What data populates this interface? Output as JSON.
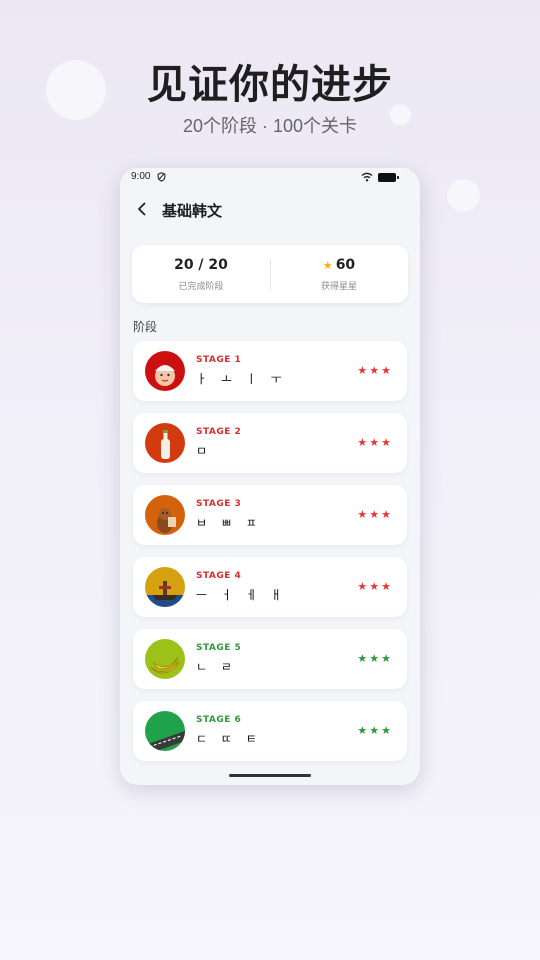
{
  "promo": {
    "headline": "见证你的进步",
    "subline": "20个阶段 · 100个关卡"
  },
  "status_bar": {
    "time": "9:00"
  },
  "header": {
    "title": "基础韩文"
  },
  "summary": {
    "completed_value": "20 / 20",
    "completed_label": "已完成阶段",
    "stars_value": "60",
    "stars_label": "获得星星"
  },
  "section": {
    "label": "阶段"
  },
  "stages": [
    {
      "stage": "STAGE 1",
      "jamo": "ㅏ ㅗ ㅣ ㅜ",
      "stars": "★★★",
      "stage_color": "#d32f2f",
      "star_color": "#e53935",
      "avatar_color": "#cc1010",
      "icon": "baby-face-icon"
    },
    {
      "stage": "STAGE 2",
      "jamo": "ㅁ",
      "stars": "★★★",
      "stage_color": "#d32f2f",
      "star_color": "#e53935",
      "avatar_color": "#d23a10",
      "icon": "bottle-icon"
    },
    {
      "stage": "STAGE 3",
      "jamo": "ㅂ ㅃ ㅍ",
      "stars": "★★★",
      "stage_color": "#d32f2f",
      "star_color": "#e53935",
      "avatar_color": "#d4620c",
      "icon": "squirrel-icon"
    },
    {
      "stage": "STAGE 4",
      "jamo": "ㅡ ㅓ ㅔ ㅐ",
      "stars": "★★★",
      "stage_color": "#d32f2f",
      "star_color": "#e53935",
      "avatar_color": "#d6a10e",
      "icon": "ship-icon"
    },
    {
      "stage": "STAGE 5",
      "jamo": "ㄴ ㄹ",
      "stars": "★★★",
      "stage_color": "#2e9a3a",
      "star_color": "#2e9a3a",
      "avatar_color": "#9cc21a",
      "icon": "banana-icon"
    },
    {
      "stage": "STAGE 6",
      "jamo": "ㄷ ㄸ ㅌ",
      "stars": "★★★",
      "stage_color": "#2e9a3a",
      "star_color": "#2e9a3a",
      "avatar_color": "#1fa24a",
      "icon": "road-icon"
    }
  ]
}
